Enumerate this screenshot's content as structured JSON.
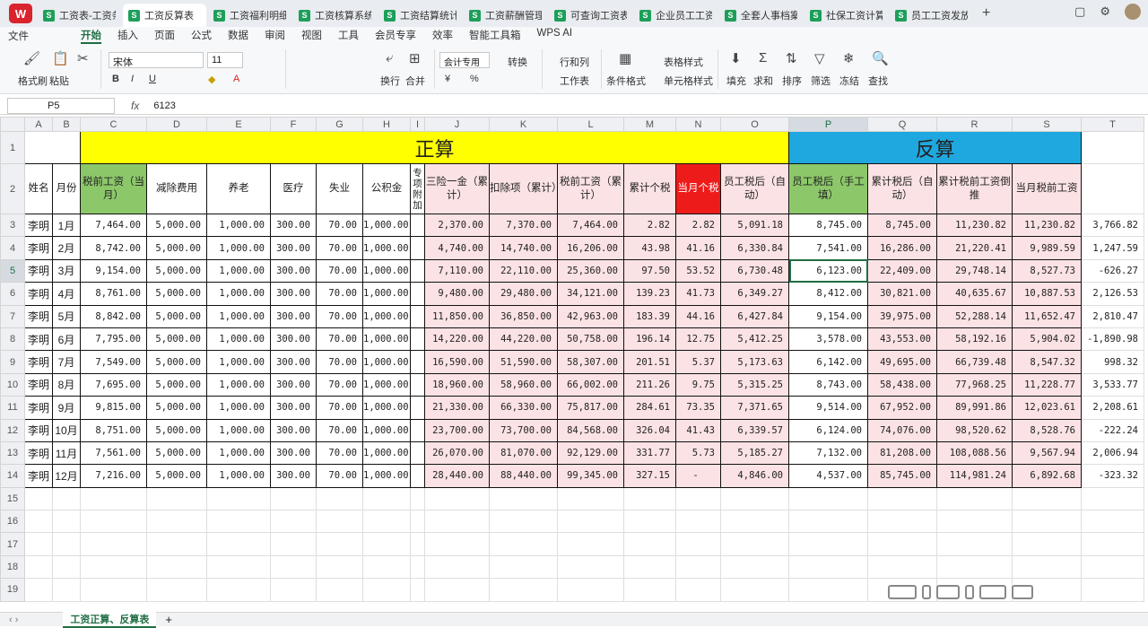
{
  "app": {
    "logo": "W"
  },
  "doc_tabs": [
    {
      "label": "工资表-工资条",
      "active": false
    },
    {
      "label": "工资反算表",
      "active": true
    },
    {
      "label": "工资福利明细",
      "active": false
    },
    {
      "label": "工资核算系统",
      "active": false
    },
    {
      "label": "工资结算统计",
      "active": false
    },
    {
      "label": "工资薪酬管理",
      "active": false
    },
    {
      "label": "可查询工资表",
      "active": false
    },
    {
      "label": "企业员工工资",
      "active": false
    },
    {
      "label": "全套人事档案",
      "active": false
    },
    {
      "label": "社保工资计算",
      "active": false
    },
    {
      "label": "员工工资发放",
      "active": false
    }
  ],
  "menu": {
    "file": "文件",
    "items": [
      "开始",
      "插入",
      "页面",
      "公式",
      "数据",
      "审阅",
      "视图",
      "工具",
      "会员专享",
      "效率",
      "智能工具箱",
      "WPS AI"
    ],
    "active": "开始"
  },
  "ribbon": {
    "format_painter": "格式刷",
    "paste": "粘贴",
    "font_name": "宋体",
    "font_size": "11",
    "wrap": "换行",
    "merge": "合并",
    "num_format": "会计专用",
    "convert": "转换",
    "row_col": "行和列",
    "worksheet": "工作表",
    "cond_format": "条件格式",
    "table_style": "表格样式",
    "cell_style": "单元格样式",
    "fill": "填充",
    "sum": "求和",
    "sort": "排序",
    "filter": "筛选",
    "freeze": "冻结",
    "find": "查找"
  },
  "formula_bar": {
    "cell_ref": "P5",
    "fx": "fx",
    "value": "6123"
  },
  "columns": [
    "A",
    "B",
    "C",
    "D",
    "E",
    "F",
    "G",
    "H",
    "I",
    "J",
    "K",
    "L",
    "M",
    "N",
    "O",
    "P",
    "Q",
    "R",
    "S",
    "T"
  ],
  "selected_column": "P",
  "section_labels": {
    "zheng": "正算",
    "fan": "反算"
  },
  "headers": [
    "姓名",
    "月份",
    "税前工资（当月）",
    "减除费用",
    "养老",
    "医疗",
    "失业",
    "公积金",
    "专项附加",
    "三险一金（累计）",
    "扣除项（累计）",
    "税前工资（累计）",
    "累计个税",
    "当月个税",
    "员工税后（自动）",
    "员工税后（手工填）",
    "累计税后（自动）",
    "累计税前工资倒推",
    "当月税前工资"
  ],
  "rows": [
    [
      "李明",
      "1月",
      "7,464.00",
      "5,000.00",
      "1,000.00",
      "300.00",
      "70.00",
      "1,000.00",
      "",
      "2,370.00",
      "7,370.00",
      "7,464.00",
      "2.82",
      "2.82",
      "5,091.18",
      "8,745.00",
      "8,745.00",
      "11,230.82",
      "11,230.82",
      "3,766.82"
    ],
    [
      "李明",
      "2月",
      "8,742.00",
      "5,000.00",
      "1,000.00",
      "300.00",
      "70.00",
      "1,000.00",
      "",
      "4,740.00",
      "14,740.00",
      "16,206.00",
      "43.98",
      "41.16",
      "6,330.84",
      "7,541.00",
      "16,286.00",
      "21,220.41",
      "9,989.59",
      "1,247.59"
    ],
    [
      "李明",
      "3月",
      "9,154.00",
      "5,000.00",
      "1,000.00",
      "300.00",
      "70.00",
      "1,000.00",
      "",
      "7,110.00",
      "22,110.00",
      "25,360.00",
      "97.50",
      "53.52",
      "6,730.48",
      "6,123.00",
      "22,409.00",
      "29,748.14",
      "8,527.73",
      "-626.27"
    ],
    [
      "李明",
      "4月",
      "8,761.00",
      "5,000.00",
      "1,000.00",
      "300.00",
      "70.00",
      "1,000.00",
      "",
      "9,480.00",
      "29,480.00",
      "34,121.00",
      "139.23",
      "41.73",
      "6,349.27",
      "8,412.00",
      "30,821.00",
      "40,635.67",
      "10,887.53",
      "2,126.53"
    ],
    [
      "李明",
      "5月",
      "8,842.00",
      "5,000.00",
      "1,000.00",
      "300.00",
      "70.00",
      "1,000.00",
      "",
      "11,850.00",
      "36,850.00",
      "42,963.00",
      "183.39",
      "44.16",
      "6,427.84",
      "9,154.00",
      "39,975.00",
      "52,288.14",
      "11,652.47",
      "2,810.47"
    ],
    [
      "李明",
      "6月",
      "7,795.00",
      "5,000.00",
      "1,000.00",
      "300.00",
      "70.00",
      "1,000.00",
      "",
      "14,220.00",
      "44,220.00",
      "50,758.00",
      "196.14",
      "12.75",
      "5,412.25",
      "3,578.00",
      "43,553.00",
      "58,192.16",
      "5,904.02",
      "-1,890.98"
    ],
    [
      "李明",
      "7月",
      "7,549.00",
      "5,000.00",
      "1,000.00",
      "300.00",
      "70.00",
      "1,000.00",
      "",
      "16,590.00",
      "51,590.00",
      "58,307.00",
      "201.51",
      "5.37",
      "5,173.63",
      "6,142.00",
      "49,695.00",
      "66,739.48",
      "8,547.32",
      "998.32"
    ],
    [
      "李明",
      "8月",
      "7,695.00",
      "5,000.00",
      "1,000.00",
      "300.00",
      "70.00",
      "1,000.00",
      "",
      "18,960.00",
      "58,960.00",
      "66,002.00",
      "211.26",
      "9.75",
      "5,315.25",
      "8,743.00",
      "58,438.00",
      "77,968.25",
      "11,228.77",
      "3,533.77"
    ],
    [
      "李明",
      "9月",
      "9,815.00",
      "5,000.00",
      "1,000.00",
      "300.00",
      "70.00",
      "1,000.00",
      "",
      "21,330.00",
      "66,330.00",
      "75,817.00",
      "284.61",
      "73.35",
      "7,371.65",
      "9,514.00",
      "67,952.00",
      "89,991.86",
      "12,023.61",
      "2,208.61"
    ],
    [
      "李明",
      "10月",
      "8,751.00",
      "5,000.00",
      "1,000.00",
      "300.00",
      "70.00",
      "1,000.00",
      "",
      "23,700.00",
      "73,700.00",
      "84,568.00",
      "326.04",
      "41.43",
      "6,339.57",
      "6,124.00",
      "74,076.00",
      "98,520.62",
      "8,528.76",
      "-222.24"
    ],
    [
      "李明",
      "11月",
      "7,561.00",
      "5,000.00",
      "1,000.00",
      "300.00",
      "70.00",
      "1,000.00",
      "",
      "26,070.00",
      "81,070.00",
      "92,129.00",
      "331.77",
      "5.73",
      "5,185.27",
      "7,132.00",
      "81,208.00",
      "108,088.56",
      "9,567.94",
      "2,006.94"
    ],
    [
      "李明",
      "12月",
      "7,216.00",
      "5,000.00",
      "1,000.00",
      "300.00",
      "70.00",
      "1,000.00",
      "",
      "28,440.00",
      "88,440.00",
      "99,345.00",
      "327.15",
      "-",
      "4,846.00",
      "4,537.00",
      "85,745.00",
      "114,981.24",
      "6,892.68",
      "-323.32"
    ]
  ],
  "sheet_tab": "工资正算、反算表",
  "colors": {
    "yellow": "#ffff00",
    "blue": "#1fa8e0",
    "green": "#8cc86a",
    "red": "#ee1b1b",
    "pink": "#fbe2e4",
    "accent": "#1f6e43"
  }
}
